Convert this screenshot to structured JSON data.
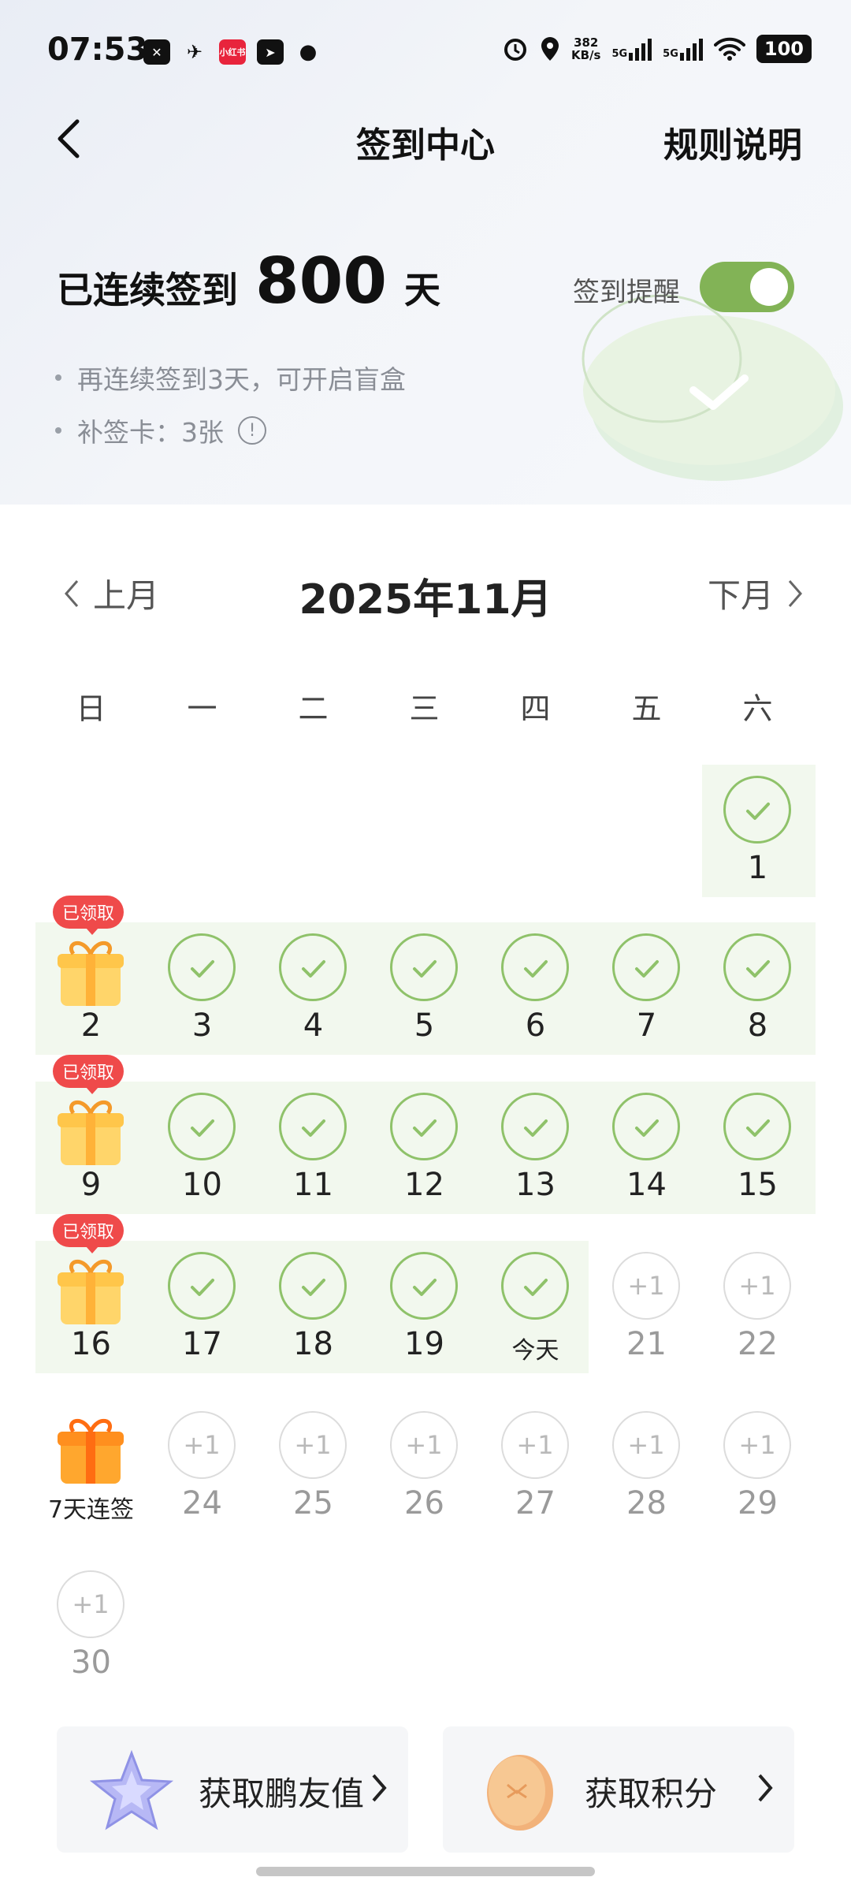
{
  "status_bar": {
    "time": "07:53",
    "net_speed": "382",
    "net_unit": "KB/s",
    "sig1": "5G",
    "sig2": "5G",
    "battery": "100",
    "app_badge": "小红书"
  },
  "header": {
    "title": "签到中心",
    "rules": "规则说明"
  },
  "streak": {
    "label": "已连续签到",
    "days": "800",
    "unit": "天",
    "reminder_label": "签到提醒",
    "reminder_on": true,
    "hint1": "再连续签到3天，可开启盲盒",
    "hint2": "补签卡：3张"
  },
  "calendar": {
    "prev": "上月",
    "next": "下月",
    "title": "2025年11月",
    "weekdays": [
      "日",
      "一",
      "二",
      "三",
      "四",
      "五",
      "六"
    ],
    "badge_claimed": "已领取",
    "weekly_gift_label": "7天连签",
    "today_label": "今天",
    "plus_label": "+1",
    "day_labels": {
      "d1": "1",
      "d2": "2",
      "d3": "3",
      "d4": "4",
      "d5": "5",
      "d6": "6",
      "d7": "7",
      "d8": "8",
      "d9": "9",
      "d10": "10",
      "d11": "11",
      "d12": "12",
      "d13": "13",
      "d14": "14",
      "d15": "15",
      "d16": "16",
      "d17": "17",
      "d18": "18",
      "d19": "19",
      "d21": "21",
      "d22": "22",
      "d24": "24",
      "d25": "25",
      "d26": "26",
      "d27": "27",
      "d28": "28",
      "d29": "29",
      "d30": "30"
    }
  },
  "actions": {
    "friend_value": "获取鹏友值",
    "points": "获取积分"
  },
  "colors": {
    "accent_green": "#82b356",
    "check_green": "#8fc26a",
    "badge_red": "#ef4a4a"
  }
}
